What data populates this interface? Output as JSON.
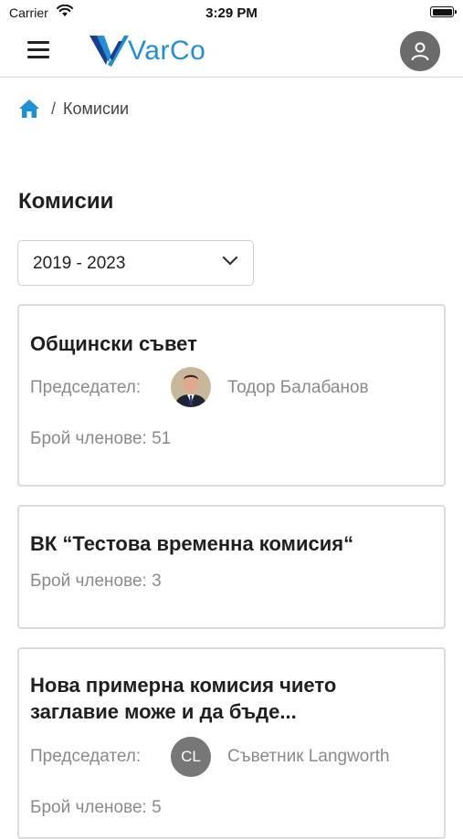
{
  "status_bar": {
    "carrier": "Carrier",
    "time": "3:29 PM"
  },
  "header": {
    "logo_text": "VarCo",
    "menu_icon": "hamburger-menu-icon",
    "profile_icon": "user-icon"
  },
  "breadcrumb": {
    "home_icon": "home-icon",
    "separator": "/",
    "current": "Комисии"
  },
  "page": {
    "title": "Комисии"
  },
  "term_select": {
    "value": "2019 - 2023",
    "icon": "chevron-down-icon"
  },
  "commissions": [
    {
      "title": "Общински съвет",
      "chair_label": "Председател:",
      "chair_name": "Тодор Балабанов",
      "members": "Брой членове: 51"
    },
    {
      "title": "ВК “Тестова временна комисия“",
      "members": "Брой членове: 3"
    },
    {
      "title_line1": "Нова примерна комисия чието",
      "title_line2": "заглавие може и да бъде...",
      "chair_label": "Председател:",
      "chair_initials": "CL",
      "chair_name": "Съветник Langworth",
      "members": "Брой членове: 5"
    }
  ],
  "colors": {
    "brand": "#1e90d6",
    "accent_dark": "#1a3d8f",
    "avatar_bg": "#6b6b6b"
  }
}
